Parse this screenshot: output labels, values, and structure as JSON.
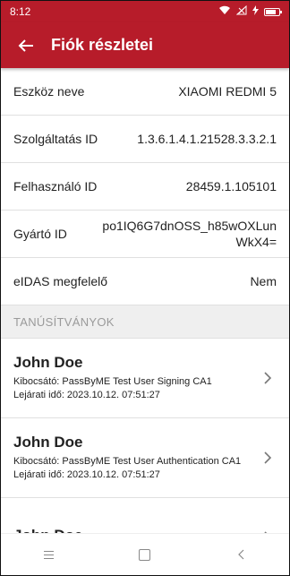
{
  "statusbar": {
    "time": "8:12"
  },
  "header": {
    "back_icon": "arrow-left-icon",
    "title": "Fiók részletei"
  },
  "details": [
    {
      "label": "Eszköz neve",
      "value": "XIAOMI REDMI 5"
    },
    {
      "label": "Szolgáltatás ID",
      "value": "1.3.6.1.4.1.21528.3.3.2.1"
    },
    {
      "label": "Felhasználó ID",
      "value": "28459.1.105101"
    },
    {
      "label": "Gyártó ID",
      "value": "po1IQ6G7dnOSS_h85wOXLunWkX4="
    },
    {
      "label": "eIDAS megfelelő",
      "value": "Nem"
    }
  ],
  "certificates_header": "TANÚSÍTVÁNYOK",
  "certificates": [
    {
      "name": "John Doe",
      "issuer": "Kibocsátó: PassByME Test User Signing CA1",
      "expiry": "Lejárati idő: 2023.10.12. 07:51:27"
    },
    {
      "name": "John Doe",
      "issuer": "Kibocsátó: PassByME Test User Authentication CA1",
      "expiry": "Lejárati idő: 2023.10.12. 07:51:27"
    },
    {
      "name": "John Doe",
      "issuer": "",
      "expiry": ""
    }
  ],
  "colors": {
    "brand": "#b71c2a",
    "section_bg": "#efefef"
  }
}
